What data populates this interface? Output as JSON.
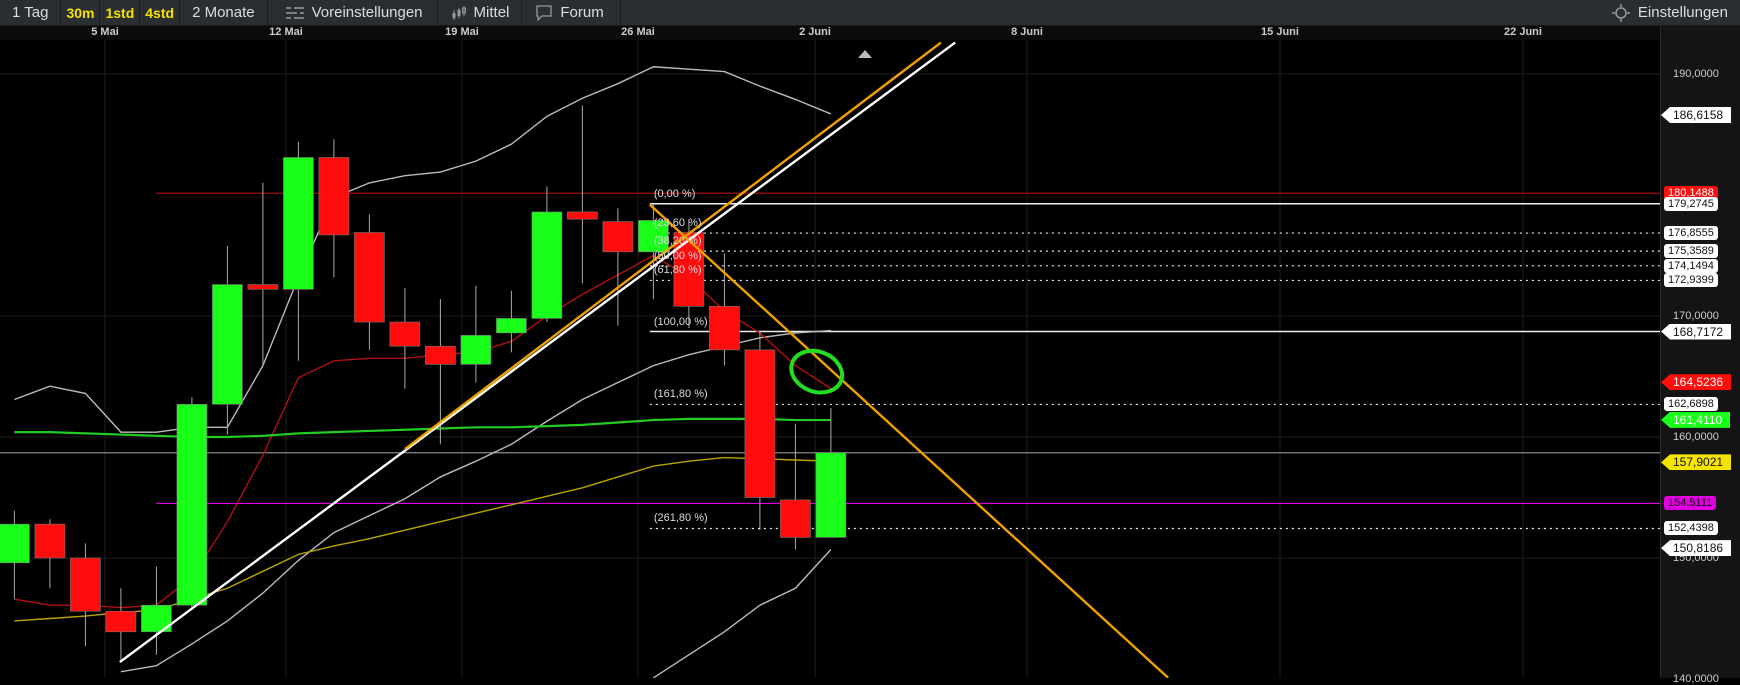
{
  "toolbar": {
    "period": "1 Tag",
    "intervals": [
      "30m",
      "1std",
      "4std"
    ],
    "range": "2 Monate",
    "presets": "Voreinstellungen",
    "indicator": "Mittel",
    "forum": "Forum",
    "settings": "Einstellungen"
  },
  "dates": [
    "5 Mai",
    "12 Mai",
    "19 Mai",
    "26 Mai",
    "2 Juni",
    "8 Juni",
    "15 Juni",
    "22 Juni"
  ],
  "colors": {
    "up": "#1aff1a",
    "down": "#ff0d0d",
    "orange": "#f0a000",
    "sma_red": "#b01010",
    "sma_green": "#22cc22",
    "sma_yellow": "#b8a400",
    "band": "#bbbbbb",
    "magenta": "#e000e0"
  },
  "chart_data": {
    "type": "candlestick",
    "ylim": [
      140,
      192.7
    ],
    "y_ticks": [
      "190,0000",
      "170,0000",
      "160,0000",
      "150,0000",
      "140,0000"
    ],
    "y_tick_values": [
      190,
      170,
      160,
      150,
      140
    ],
    "candles": [
      {
        "o": 149.6,
        "h": 153.9,
        "l": 146.6,
        "c": 152.8
      },
      {
        "o": 152.8,
        "h": 153.2,
        "l": 147.5,
        "c": 150.0
      },
      {
        "o": 150.0,
        "h": 151.2,
        "l": 142.7,
        "c": 145.6
      },
      {
        "o": 145.6,
        "h": 147.5,
        "l": 141.6,
        "c": 143.9
      },
      {
        "o": 143.9,
        "h": 149.3,
        "l": 142.0,
        "c": 146.1
      },
      {
        "o": 146.1,
        "h": 163.3,
        "l": 145.7,
        "c": 162.7
      },
      {
        "o": 162.7,
        "h": 175.8,
        "l": 160.2,
        "c": 172.6
      },
      {
        "o": 172.6,
        "h": 181.0,
        "l": 165.9,
        "c": 172.2
      },
      {
        "o": 172.2,
        "h": 184.4,
        "l": 166.3,
        "c": 183.1
      },
      {
        "o": 183.1,
        "h": 184.6,
        "l": 173.2,
        "c": 176.7
      },
      {
        "o": 176.9,
        "h": 178.4,
        "l": 167.2,
        "c": 169.5
      },
      {
        "o": 169.5,
        "h": 172.3,
        "l": 164.0,
        "c": 167.5
      },
      {
        "o": 167.5,
        "h": 171.4,
        "l": 159.4,
        "c": 166.0
      },
      {
        "o": 166.0,
        "h": 172.5,
        "l": 164.5,
        "c": 168.4
      },
      {
        "o": 168.6,
        "h": 172.1,
        "l": 167.0,
        "c": 169.8
      },
      {
        "o": 169.8,
        "h": 180.7,
        "l": 169.5,
        "c": 178.6
      },
      {
        "o": 178.6,
        "h": 187.4,
        "l": 172.7,
        "c": 178.0
      },
      {
        "o": 177.8,
        "h": 178.9,
        "l": 169.2,
        "c": 175.3
      },
      {
        "o": 175.3,
        "h": 179.2,
        "l": 171.4,
        "c": 177.9
      },
      {
        "o": 176.9,
        "h": 178.0,
        "l": 169.0,
        "c": 170.8
      },
      {
        "o": 170.8,
        "h": 175.2,
        "l": 165.9,
        "c": 167.2
      },
      {
        "o": 167.2,
        "h": 168.8,
        "l": 152.3,
        "c": 155.0
      },
      {
        "o": 154.8,
        "h": 161.1,
        "l": 150.7,
        "c": 151.7
      },
      {
        "o": 151.7,
        "h": 162.4,
        "l": 151.7,
        "c": 158.7
      }
    ],
    "series": [
      {
        "name": "upper_band",
        "color": "#bbbbbb",
        "start": 0,
        "values": [
          163.1,
          164.2,
          163.6,
          160.4,
          160.4,
          160.8,
          160.8,
          165.9,
          173.2,
          179.8,
          181.0,
          181.6,
          181.9,
          182.8,
          184.2,
          186.5,
          188.0,
          189.2,
          190.6,
          190.4,
          190.2,
          189.0,
          187.9,
          186.7
        ]
      },
      {
        "name": "middle_band",
        "color": "#bbbbbb",
        "start": 3,
        "values": [
          140.6,
          141.1,
          142.9,
          144.8,
          147.1,
          149.8,
          152.1,
          153.5,
          154.9,
          156.7,
          158.0,
          159.4,
          161.3,
          163.1,
          164.5,
          165.9,
          166.8,
          167.5,
          168.2,
          168.6,
          168.8
        ]
      },
      {
        "name": "lower_band",
        "color": "#bbbbbb",
        "start": 18,
        "values": [
          140.1,
          142.0,
          143.9,
          146.1,
          147.5,
          150.7
        ]
      },
      {
        "name": "sma_red",
        "color": "#b01010",
        "start": 0,
        "values": [
          146.6,
          146.1,
          146.1,
          145.9,
          146.1,
          148.4,
          153.0,
          158.5,
          164.9,
          166.3,
          166.5,
          166.5,
          166.8,
          167.0,
          167.9,
          170.0,
          171.8,
          173.4,
          175.0,
          173.2,
          170.4,
          168.6,
          165.9,
          164.0
        ]
      },
      {
        "name": "sma_green",
        "color": "#22cc22",
        "start": 0,
        "values": [
          160.4,
          160.4,
          160.3,
          160.2,
          160.1,
          160.0,
          160.0,
          160.1,
          160.3,
          160.4,
          160.5,
          160.6,
          160.7,
          160.8,
          160.8,
          160.9,
          161.0,
          161.2,
          161.4,
          161.5,
          161.5,
          161.5,
          161.4,
          161.4
        ]
      },
      {
        "name": "sma_yellow",
        "color": "#b8a400",
        "start": 0,
        "values": [
          144.8,
          145.0,
          145.2,
          145.5,
          145.7,
          146.6,
          147.5,
          148.9,
          150.3,
          151.0,
          151.6,
          152.3,
          153.0,
          153.7,
          154.4,
          155.1,
          155.8,
          156.7,
          157.6,
          158.0,
          158.3,
          158.2,
          158.1,
          158.0
        ]
      }
    ],
    "trendlines": [
      {
        "color": "#ffffff",
        "from": [
          2.97,
          141.4
        ],
        "to": [
          26.5,
          192.6
        ]
      },
      {
        "color": "#f0a000",
        "from": [
          11,
          159.0
        ],
        "to": [
          26.1,
          192.6
        ]
      },
      {
        "color": "#f0a000",
        "from": [
          17.9,
          179.2
        ],
        "to": [
          32.5,
          140.1
        ]
      }
    ],
    "hlines": [
      {
        "price": 180.1488,
        "color": "#b01010",
        "from": 4,
        "style": "solid"
      },
      {
        "price": 158.7,
        "color": "#888888",
        "from": -1,
        "style": "solid"
      },
      {
        "price": 154.5111,
        "color": "#e000e0",
        "from": 4,
        "style": "solid"
      }
    ],
    "fibonacci": {
      "from": 17.9,
      "levels": [
        {
          "label": "(0,00 %)",
          "price": 179.2745,
          "style": "solid"
        },
        {
          "label": "(23,60 %)",
          "price": 176.8555,
          "style": "dotted"
        },
        {
          "label": "(38,20 %)",
          "price": 175.3589,
          "style": "dotted"
        },
        {
          "label": "(50,00 %)",
          "price": 174.1494,
          "style": "dotted"
        },
        {
          "label": "(61,80 %)",
          "price": 172.9399,
          "style": "dotted"
        },
        {
          "label": "(100,00 %)",
          "price": 168.7172,
          "style": "solid"
        },
        {
          "label": "(161,80 %)",
          "price": 162.6898,
          "style": "dotted"
        },
        {
          "label": "(261,80 %)",
          "price": 152.4398,
          "style": "dotted"
        }
      ]
    },
    "annotation_circle": {
      "index": 22.6,
      "price": 165.4
    },
    "price_tags": [
      {
        "text": "186,6158",
        "price": 186.6158,
        "bg": "#ffffff",
        "fg": "#111",
        "arrow": true
      },
      {
        "text": "180,1488",
        "price": 180.1488,
        "bg": "#ff0d0d",
        "fg": "#fff",
        "arrow": false
      },
      {
        "text": "179,2745",
        "price": 179.2745,
        "bg": "#ffffff",
        "fg": "#111",
        "arrow": false
      },
      {
        "text": "176,8555",
        "price": 176.8555,
        "bg": "#ffffff",
        "fg": "#111",
        "arrow": false
      },
      {
        "text": "175,3589",
        "price": 175.3589,
        "bg": "#ffffff",
        "fg": "#111",
        "arrow": false
      },
      {
        "text": "174,1494",
        "price": 174.1494,
        "bg": "#ffffff",
        "fg": "#111",
        "arrow": false
      },
      {
        "text": "172,9399",
        "price": 172.9399,
        "bg": "#ffffff",
        "fg": "#111",
        "arrow": false
      },
      {
        "text": "168,7172",
        "price": 168.7172,
        "bg": "#ffffff",
        "fg": "#111",
        "arrow": true
      },
      {
        "text": "164,5236",
        "price": 164.5236,
        "bg": "#ff0d0d",
        "fg": "#fff",
        "arrow": true
      },
      {
        "text": "162,6898",
        "price": 162.6898,
        "bg": "#ffffff",
        "fg": "#111",
        "arrow": false
      },
      {
        "text": "161,4110",
        "price": 161.411,
        "bg": "#1aff1a",
        "fg": "#fff",
        "arrow": true
      },
      {
        "text": "157,9021",
        "price": 157.9021,
        "bg": "#f5e400",
        "fg": "#111",
        "arrow": true
      },
      {
        "text": "154,5111",
        "price": 154.5111,
        "bg": "#e000e0",
        "fg": "#111",
        "arrow": false
      },
      {
        "text": "152,4398",
        "price": 152.4398,
        "bg": "#ffffff",
        "fg": "#111",
        "arrow": false
      },
      {
        "text": "150,8186",
        "price": 150.8186,
        "bg": "#ffffff",
        "fg": "#111",
        "arrow": true
      }
    ]
  }
}
